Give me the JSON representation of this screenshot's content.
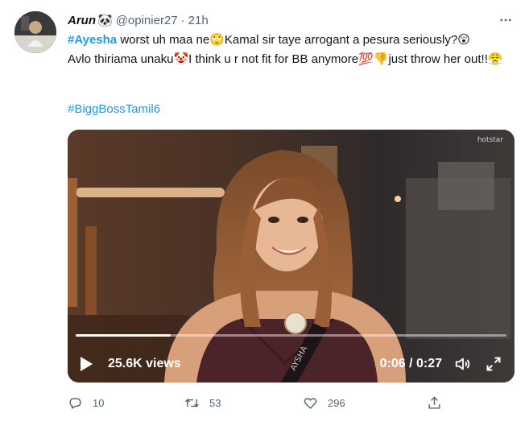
{
  "tweet": {
    "author_name": "Arun",
    "name_emoji": "🐼",
    "handle": "@opinier27",
    "separator": "·",
    "time": "21h",
    "more_icon": "ellipsis-icon",
    "text": {
      "hashtag1": "#Ayesha",
      "p1": " worst uh maa ne",
      "e1": "🙄",
      "p2": "Kamal sir taye arrogant a pesura seriously?",
      "e2": "😲",
      "p3": "Avlo thiriama unaku",
      "e3": "🤡",
      "p4": "I think u r not fit for BB anymore",
      "e4": "💯",
      "e5": "👎",
      "p5": "just throw her out!!",
      "e6": "😤"
    },
    "hashtag2": "#BiggBossTamil6"
  },
  "video": {
    "watermark": "hotstar",
    "views": "25.6K views",
    "timecode": "0:06 / 0:27",
    "progress": 0.22,
    "play_icon": "play-icon",
    "volume_icon": "volume-icon",
    "fullscreen_icon": "fullscreen-icon",
    "sash_text": "AYSHA"
  },
  "actions": {
    "reply_count": "10",
    "retweet_count": "53",
    "like_count": "296"
  },
  "colors": {
    "link": "#1d9bf0",
    "muted": "#536471",
    "text": "#0f1419"
  }
}
